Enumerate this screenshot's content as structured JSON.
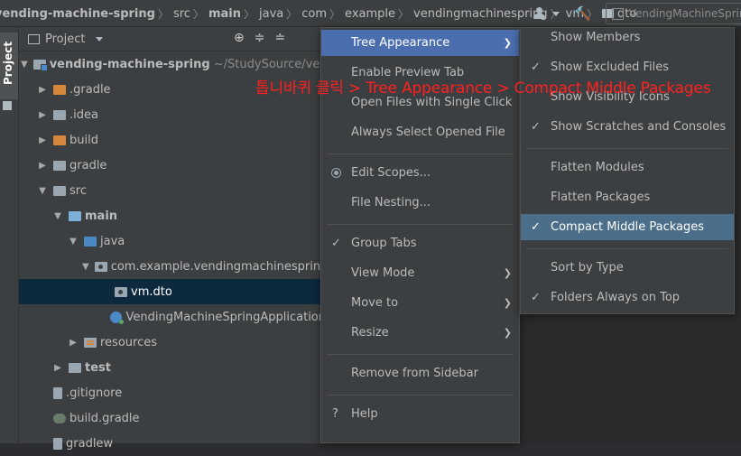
{
  "breadcrumb": [
    "vending-machine-spring",
    "src",
    "main",
    "java",
    "com",
    "example",
    "vendingmachinespring",
    "vm",
    "dto"
  ],
  "run_config": "VendingMachineSpringApplication",
  "stripe": {
    "project_tab": "Project"
  },
  "panel": {
    "title": "Project",
    "tree": [
      {
        "name": "vending-machine-spring",
        "extra": "~/StudySource/vending"
      },
      {
        "name": ".gradle"
      },
      {
        "name": ".idea"
      },
      {
        "name": "build"
      },
      {
        "name": "gradle"
      },
      {
        "name": "src"
      },
      {
        "name": "main"
      },
      {
        "name": "java"
      },
      {
        "name": "com.example.vendingmachinespring"
      },
      {
        "name": "vm.dto"
      },
      {
        "name": "VendingMachineSpringApplication"
      },
      {
        "name": "resources"
      },
      {
        "name": "test"
      },
      {
        "name": ".gitignore"
      },
      {
        "name": "build.gradle"
      },
      {
        "name": "gradlew"
      }
    ]
  },
  "menu_main": {
    "items": [
      "Tree Appearance",
      "Enable Preview Tab",
      "Open Files with Single Click",
      "Always Select Opened File",
      "Edit Scopes...",
      "File Nesting...",
      "Group Tabs",
      "View Mode",
      "Move to",
      "Resize",
      "Remove from Sidebar",
      "Help"
    ]
  },
  "menu_tree": {
    "items": [
      "Show Members",
      "Show Excluded Files",
      "Show Visibility Icons",
      "Show Scratches and Consoles",
      "Flatten Modules",
      "Flatten Packages",
      "Compact Middle Packages",
      "Sort by Type",
      "Folders Always on Top"
    ]
  },
  "annotation": "톱니바퀴 클릭 > Tree Appearance > Compact Middle Packages",
  "colors": {
    "menu_active": "#4b6eaf",
    "menu_selected": "#4b6e8a",
    "annotation": "#ff2020"
  }
}
